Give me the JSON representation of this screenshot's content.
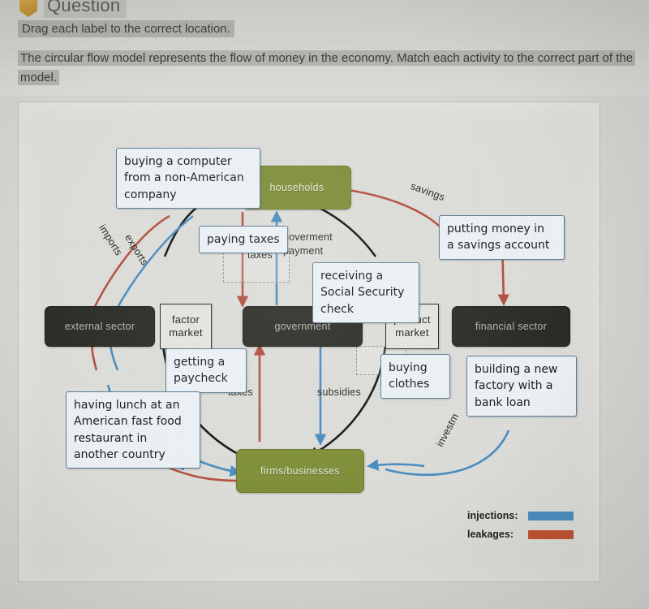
{
  "header": {
    "icon": "question-badge-icon",
    "title": "Question",
    "instruction": "Drag each label to the correct location.",
    "prompt": "The circular flow model represents the flow of money in the economy. Match each activity to the correct part of the model."
  },
  "diagram": {
    "title": "circular flow model",
    "nodes": [
      {
        "id": "households",
        "label": "households",
        "style": "green"
      },
      {
        "id": "external-sector",
        "label": "external sector",
        "style": "dark"
      },
      {
        "id": "government",
        "label": "government",
        "style": "dark"
      },
      {
        "id": "financial-sector",
        "label": "financial sector",
        "style": "dark"
      },
      {
        "id": "firms",
        "label": "firms/businesses",
        "style": "green"
      },
      {
        "id": "factor-market",
        "label": "factor\nmarket",
        "style": "plain"
      },
      {
        "id": "product-market",
        "label": "product\nmarket",
        "style": "plain"
      }
    ],
    "factor_market_line1": "factor",
    "factor_market_line2": "market",
    "product_market_line1": "product",
    "product_market_line2": "market",
    "flow_labels": [
      {
        "id": "imports",
        "text": "imports",
        "color": "#b4503f"
      },
      {
        "id": "exports",
        "text": "exports",
        "color": "#4a8ec2"
      },
      {
        "id": "savings",
        "text": "savings",
        "color": "#b4503f"
      },
      {
        "id": "investment",
        "text": "investm",
        "color": "#4a8ec2"
      },
      {
        "id": "taxes-top",
        "text": "taxes",
        "color": "#b4503f"
      },
      {
        "id": "government-payment",
        "text": "goverment\npayment",
        "color": "#4a8ec2"
      },
      {
        "id": "taxes-bottom",
        "text": "taxes",
        "color": "#b4503f"
      },
      {
        "id": "subsidies",
        "text": "subsidies",
        "color": "#4a8ec2"
      }
    ],
    "taxes_top_text": "taxes",
    "government_payment_line1": "goverment",
    "government_payment_line2": "payment",
    "taxes_bottom_text": "taxes",
    "subsidies_text": "subsidies",
    "answer_labels": [
      {
        "id": "label-computer",
        "text": "buying a computer from a non-American company"
      },
      {
        "id": "label-paying-tax",
        "text": "paying taxes"
      },
      {
        "id": "label-savings",
        "text": "putting money in a savings account"
      },
      {
        "id": "label-ss-check",
        "text": "receiving a Social Security check"
      },
      {
        "id": "label-paycheck",
        "text": "getting a paycheck"
      },
      {
        "id": "label-lunch",
        "text": "having lunch at an American fast food restaurant in another country"
      },
      {
        "id": "label-clothes",
        "text": "buying clothes"
      },
      {
        "id": "label-factory",
        "text": "building a new factory with a bank loan"
      }
    ],
    "answer_text": {
      "computer_l1": "buying a computer",
      "computer_l2": "from a non-American",
      "computer_l3": "company",
      "paying_taxes": "paying taxes",
      "savings_l1": "putting money in",
      "savings_l2": "a savings account",
      "ss_l1": "receiving a",
      "ss_l2": "Social Security",
      "ss_l3": "check",
      "paycheck_l1": "getting a",
      "paycheck_l2": "paycheck",
      "lunch_l1": "having lunch at an",
      "lunch_l2": "American fast food",
      "lunch_l3": "restaurant in",
      "lunch_l4": "another country",
      "clothes_l1": "buying",
      "clothes_l2": "clothes",
      "factory_l1": "building a new",
      "factory_l2": "factory with a",
      "factory_l3": "bank loan"
    },
    "legend": {
      "injections_label": "injections:",
      "leakages_label": "leakages:",
      "injections_color": "#4a8ec2",
      "leakages_color": "#c2512f"
    },
    "colors": {
      "green_node": "#7f9038",
      "dark_node": "#2c2c27",
      "injection_blue": "#4a8ec2",
      "leakage_red": "#b4503f",
      "neutral_black": "#1c1c1c",
      "canvas": "#dfdfdb"
    }
  }
}
